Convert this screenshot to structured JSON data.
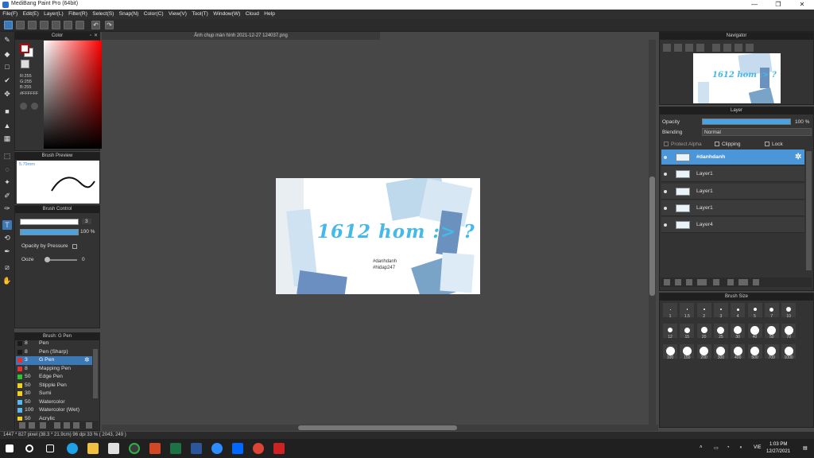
{
  "window": {
    "title": "MediBang Paint Pro (64bit)",
    "min": "—",
    "max": "❐",
    "close": "✕"
  },
  "menu": [
    "File(F)",
    "Edit(E)",
    "Layer(L)",
    "Filter(R)",
    "Select(S)",
    "Snap(N)",
    "Color(C)",
    "View(V)",
    "Tool(T)",
    "Window(W)",
    "Cloud",
    "Help"
  ],
  "panels": {
    "color": {
      "title": "Color",
      "r": "R:255",
      "g": "G:255",
      "b": "B:255",
      "hex": "#FFFFFF"
    },
    "brush_preview": {
      "title": "Brush Preview",
      "size": "5.79mm"
    },
    "brush_control": {
      "title": "Brush Control",
      "size_value": "3",
      "opacity_value": "100 %",
      "opacity_by_pressure": "Opacity by Pressure",
      "ooze_label": "Ooze",
      "ooze_value": "0"
    },
    "brush_list": {
      "title": "Brush: G Pen",
      "items": [
        {
          "num": "8",
          "name": "Pen",
          "color": "#1a1a1a"
        },
        {
          "num": "8",
          "name": "Pen (Sharp)",
          "color": "#1a1a1a"
        },
        {
          "num": "3",
          "name": "G Pen",
          "color": "#e53030"
        },
        {
          "num": "8",
          "name": "Mapping Pen",
          "color": "#e53030"
        },
        {
          "num": "50",
          "name": "Edge Pen",
          "color": "#2ec22e"
        },
        {
          "num": "50",
          "name": "Stipple Pen",
          "color": "#f0d020"
        },
        {
          "num": "30",
          "name": "Sumi",
          "color": "#f0d020"
        },
        {
          "num": "50",
          "name": "Watercolor",
          "color": "#58b8f0"
        },
        {
          "num": "100",
          "name": "Watercolor (Wet)",
          "color": "#58b8f0"
        },
        {
          "num": "50",
          "name": "Acrylic",
          "color": "#f0d020"
        }
      ]
    },
    "navigator": {
      "title": "Navigator"
    },
    "layer": {
      "title": "Layer",
      "opacity_label": "Opacity",
      "opacity_value": "100 %",
      "blending_label": "Blending",
      "blending_value": "Normal",
      "protect_alpha": "Protect Alpha",
      "clipping": "Clipping",
      "lock": "Lock",
      "layers": [
        "#danhdanh",
        "Layer1",
        "Layer1",
        "Layer1",
        "Layer4"
      ]
    },
    "brush_size": {
      "title": "Brush Size",
      "rows": [
        [
          "1",
          "1.5",
          "2",
          "3",
          "4",
          "5",
          "7",
          "10"
        ],
        [
          "12",
          "15",
          "20",
          "25",
          "30",
          "40",
          "50",
          "70"
        ],
        [
          "100",
          "150",
          "200",
          "300",
          "400",
          "500",
          "700",
          "1000"
        ]
      ]
    }
  },
  "document": {
    "tab": "Ảnh chụp màn hình 2021-12-27 124037.png",
    "headline": "1612 hom :> ?",
    "sub1": "#danhdanh",
    "sub2": "#hidap247"
  },
  "status": "1447 * 827 pixel  (38.3 * 21.9cm)  96 dpi  33 %  ( 2043, 249 )",
  "taskbar": {
    "lang": "VIE",
    "time": "1:03 PM",
    "date": "12/27/2021"
  },
  "colors": {
    "accent": "#3c78b6",
    "layer_selected": "#4a96d8",
    "headline": "#45b9e8"
  }
}
